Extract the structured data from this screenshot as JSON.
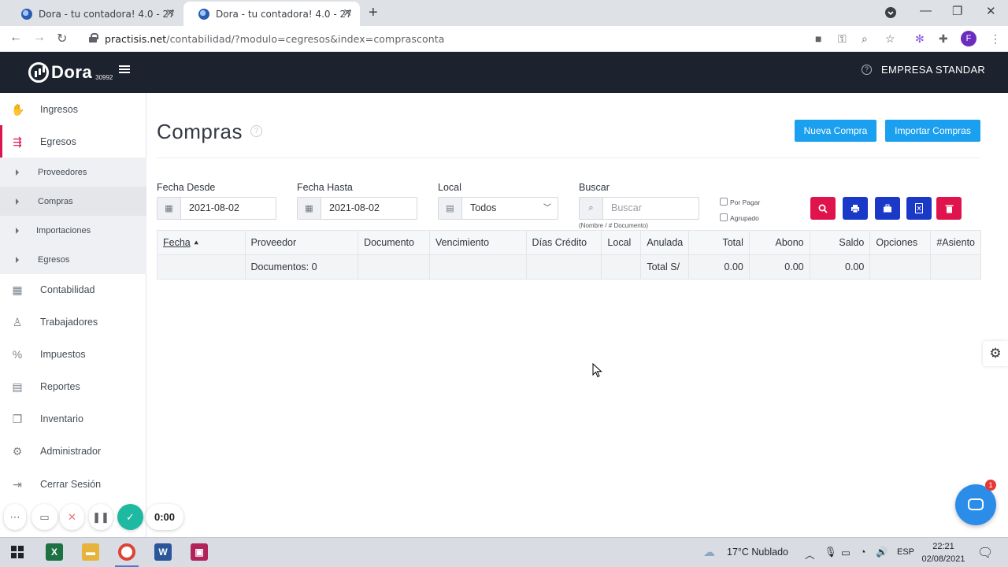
{
  "browser": {
    "tabs": [
      {
        "title": "Dora - tu contadora! 4.0 - 27",
        "active": false
      },
      {
        "title": "Dora - tu contadora! 4.0 - 27",
        "active": true
      }
    ],
    "url_host": "practisis.net",
    "url_path": "/contabilidad/?modulo=cegresos&index=comprasconta",
    "profile_initial": "F"
  },
  "header": {
    "logo_text": "Dora",
    "logo_number": "30992",
    "company": "EMPRESA STANDAR"
  },
  "sidebar": {
    "items": [
      {
        "label": "Ingresos",
        "icon": "hand-coins-icon"
      },
      {
        "label": "Egresos",
        "icon": "money-out-icon"
      },
      {
        "label": "Contabilidad",
        "icon": "calculator-icon"
      },
      {
        "label": "Trabajadores",
        "icon": "people-icon"
      },
      {
        "label": "Impuestos",
        "icon": "tax-icon"
      },
      {
        "label": "Reportes",
        "icon": "report-icon"
      },
      {
        "label": "Inventario",
        "icon": "boxes-icon"
      },
      {
        "label": "Administrador",
        "icon": "gear-icon"
      },
      {
        "label": "Cerrar Sesión",
        "icon": "logout-icon"
      }
    ],
    "subitems": [
      "Proveedores",
      "Compras",
      "Importaciones",
      "Egresos"
    ]
  },
  "page": {
    "title": "Compras",
    "nueva_compra": "Nueva Compra",
    "importar_compras": "Importar Compras"
  },
  "filters": {
    "fecha_desde_label": "Fecha Desde",
    "fecha_desde_value": "2021-08-02",
    "fecha_hasta_label": "Fecha Hasta",
    "fecha_hasta_value": "2021-08-02",
    "local_label": "Local",
    "local_value": "Todos",
    "buscar_label": "Buscar",
    "buscar_placeholder": "Buscar",
    "buscar_hint": "(Nombre / # Documento)",
    "por_pagar": "Por Pagar",
    "agrupado": "Agrupado"
  },
  "table": {
    "headers": [
      "Fecha",
      "Proveedor",
      "Documento",
      "Vencimiento",
      "Días Crédito",
      "Local",
      "Anulada",
      "Total",
      "Abono",
      "Saldo",
      "Opciones",
      "#Asiento"
    ],
    "summary": {
      "documentos": "Documentos: 0",
      "total_label": "Total S/",
      "total": "0.00",
      "abono": "0.00",
      "saldo": "0.00"
    }
  },
  "recorder": {
    "timer": "0:00"
  },
  "taskbar": {
    "weather": "17°C  Nublado",
    "lang": "ESP",
    "time": "22:21",
    "date": "02/08/2021"
  },
  "colors": {
    "header_bg": "#1c222e",
    "accent_blue": "#1aa0ef",
    "danger_red": "#e0144c",
    "action_blue": "#1b39c7",
    "active_sidebar": "#d9164f"
  }
}
